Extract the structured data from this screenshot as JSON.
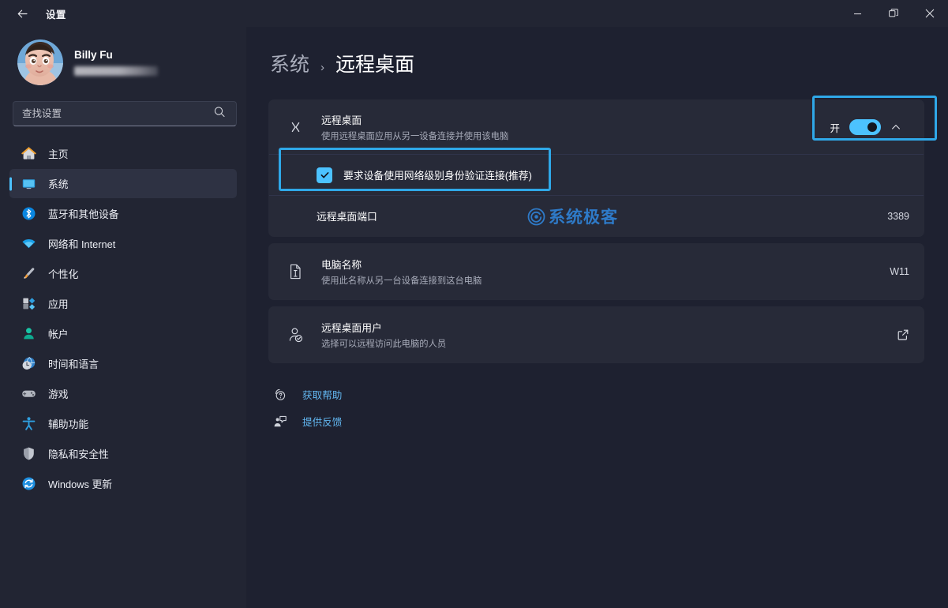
{
  "titlebar": {
    "back_label": "back-arrow",
    "title": "设置",
    "minimize": "minimize",
    "restore": "restore",
    "close": "close"
  },
  "sidebar": {
    "profile": {
      "name": "Billy Fu",
      "email_masked": ""
    },
    "search": {
      "placeholder": "查找设置",
      "value": ""
    },
    "items": [
      {
        "label": "主页",
        "icon": "home-icon",
        "active": false
      },
      {
        "label": "系统",
        "icon": "system-icon",
        "active": true
      },
      {
        "label": "蓝牙和其他设备",
        "icon": "bluetooth-icon",
        "active": false
      },
      {
        "label": "网络和 Internet",
        "icon": "network-icon",
        "active": false
      },
      {
        "label": "个性化",
        "icon": "personalization-icon",
        "active": false
      },
      {
        "label": "应用",
        "icon": "apps-icon",
        "active": false
      },
      {
        "label": "帐户",
        "icon": "accounts-icon",
        "active": false
      },
      {
        "label": "时间和语言",
        "icon": "time-language-icon",
        "active": false
      },
      {
        "label": "游戏",
        "icon": "gaming-icon",
        "active": false
      },
      {
        "label": "辅助功能",
        "icon": "accessibility-icon",
        "active": false
      },
      {
        "label": "隐私和安全性",
        "icon": "privacy-security-icon",
        "active": false
      },
      {
        "label": "Windows 更新",
        "icon": "windows-update-icon",
        "active": false
      }
    ]
  },
  "breadcrumb": {
    "parent": "系统",
    "separator": "›",
    "current": "远程桌面"
  },
  "main": {
    "remote_desktop": {
      "title": "远程桌面",
      "subtitle": "使用远程桌面应用从另一设备连接并使用该电脑",
      "toggle_label": "开",
      "toggle_on": true,
      "expanded": true,
      "nla_label": "要求设备使用网络级别身份验证连接(推荐)",
      "nla_checked": true,
      "port_label": "远程桌面端口",
      "port_value": "3389"
    },
    "computer_name": {
      "title": "电脑名称",
      "subtitle": "使用此名称从另一台设备连接到这台电脑",
      "value": "W11"
    },
    "remote_users": {
      "title": "远程桌面用户",
      "subtitle": "选择可以远程访问此电脑的人员",
      "action_icon": "external-link-icon"
    },
    "links": [
      {
        "label": "获取帮助",
        "icon": "help-icon"
      },
      {
        "label": "提供反馈",
        "icon": "feedback-icon"
      }
    ]
  },
  "watermark": {
    "text": "系统极客"
  },
  "colors": {
    "accent": "#4cc2ff",
    "highlight_box": "#2fa8e8",
    "page_bg": "#1e2130",
    "card_bg": "#272a38",
    "sidebar_bg": "#222533",
    "link": "#62b7f0"
  }
}
